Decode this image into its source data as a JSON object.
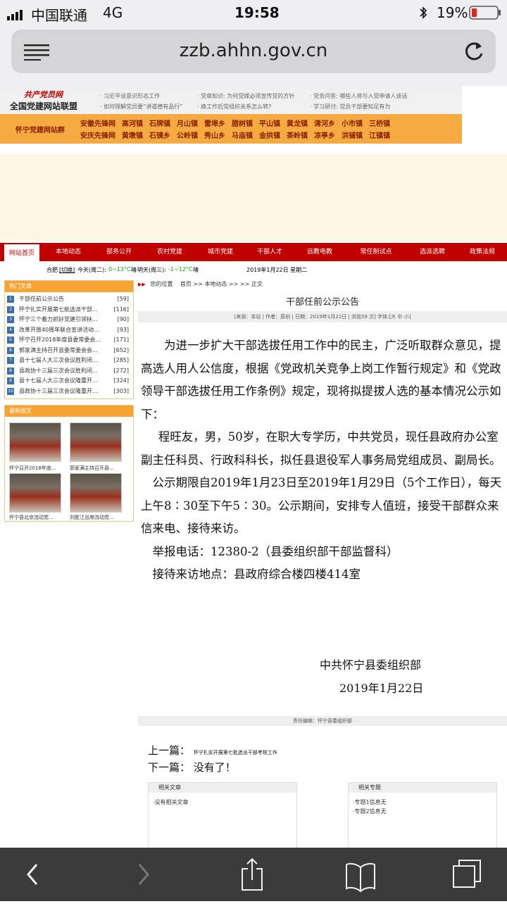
{
  "status_bar": {
    "carrier": "中国联通",
    "network": "4G",
    "time": "19:58",
    "battery": "19%"
  },
  "browser": {
    "url": "zzb.ahhn.gov.cn"
  },
  "header": {
    "logo_top": "共产党员网",
    "logo_bottom": "全国党建网站联盟",
    "links": [
      "· 习近平谈意识形态工作",
      "· 如何理解党员要“讲道德有品行”",
      "· 党章知识: 为何党媒必须宣传党的方针",
      "· 换工作后党组织关系怎么转?",
      "· 党务问答: 哪些人将与入党申请人谈话",
      "· 学习研讨: 党员干部要知足有为"
    ],
    "group_label": "怀宁党建网站群",
    "towns_row1": [
      "安徽先锋网",
      "高河镇",
      "石牌镇",
      "月山镇",
      "雷埠乡",
      "腊树镇",
      "平山镇",
      "黄龙镇",
      "清河乡",
      "小市镇",
      "三桥镇"
    ],
    "towns_row2": [
      "安庆先锋网",
      "黄墩镇",
      "石镜乡",
      "公岭镇",
      "秀山乡",
      "马庙镇",
      "金拱镇",
      "茶岭镇",
      "凉亭乡",
      "洪铺镇",
      "江镇镇"
    ]
  },
  "nav": {
    "items": [
      "网站首页",
      "本地动态",
      "部务公开",
      "农村党建",
      "城市党建",
      "干部人才",
      "远教电教",
      "常任制试点",
      "选派选聘",
      "政策法规"
    ]
  },
  "weather": {
    "city": "合肥",
    "switch": "[切换]",
    "today_label": "今天(周二):",
    "today_temp": "0~13°C",
    "today_desc": "晴",
    "tomorrow_label": "明天(周三):",
    "tomorrow_temp": "-1~12°C",
    "tomorrow_desc": "晴",
    "date": "2019年1月22日 星期二"
  },
  "hot_articles": {
    "heading": "热门文章",
    "items": [
      {
        "num": "1",
        "title": "干部任前公示公告",
        "count": "[59]"
      },
      {
        "num": "2",
        "title": "怀宁扎实开展第七批选派干部...",
        "count": "[116]"
      },
      {
        "num": "3",
        "title": "怀宁三个着力抓好党建引领扶...",
        "count": "[90]"
      },
      {
        "num": "4",
        "title": "改革开放40周年联合宣讲活动...",
        "count": "[93]"
      },
      {
        "num": "5",
        "title": "怀宁召开2018年度县委常委会...",
        "count": "[171]"
      },
      {
        "num": "6",
        "title": "郭家满主持召开县委常委会会...",
        "count": "[652]"
      },
      {
        "num": "7",
        "title": "县十七届人大三次会议胜利闭...",
        "count": "[285]"
      },
      {
        "num": "8",
        "title": "县政协十三届三次会议胜利闭...",
        "count": "[272]"
      },
      {
        "num": "9",
        "title": "县十七届人大三次会议隆重开...",
        "count": "[324]"
      },
      {
        "num": "10",
        "title": "县政协十三届三次会议隆重开...",
        "count": "[303]"
      }
    ]
  },
  "latest_photos": {
    "heading": "最新图文",
    "items": [
      "怀宁召开2018年度...",
      "郭家满主持召开县...",
      "怀宁县北京流动党...",
      "刘胜江出席流动党..."
    ]
  },
  "article": {
    "breadcrumb_label": "您的位置",
    "breadcrumb": [
      "首页",
      ">>",
      "本地动态",
      ">>",
      ">>",
      "正文"
    ],
    "title": "干部任前公示公告",
    "meta": "[来源：本站 | 作者：原创 | 日期：2019年1月22日 | 浏览59 次] 字体:[大 中 小]",
    "paragraphs": [
      "为进一步扩大干部选拔任用工作中的民主，广泛听取群众意见，提高选人用人公信度，根据《党政机关竞争上岗工作暂行规定》和《党政领导干部选拔任用工作条例》规定，现将拟提拔人选的基本情况公示如下：",
      "程旺友，男，50岁，在职大专学历，中共党员，现任县政府办公室副主任科员、行政科科长，拟任县退役军人事务局党组成员、副局长。",
      "公示期限自2019年1月23日至2019年1月29日（5个工作日），每天上午8∶30至下午5∶30。公示期间，安排专人值班，接受干部群众来信来电、接待来访。",
      "举报电话：12380-2（县委组织部干部监督科）",
      "接待来访地点：县政府综合楼四楼414室"
    ],
    "signature_org": "中共怀宁县委组织部",
    "signature_date": "2019年1月22日",
    "editor": "责任编辑：怀宁县委组织部",
    "prev_label": "上一篇：",
    "prev_title": "怀宁扎实开展第七批选派干部考核工作",
    "next_label": "下一篇：",
    "next_title": "没有了！",
    "related_articles_heading": "相关文章",
    "related_articles": [
      "·没有相关文章"
    ],
    "related_topics_heading": "相关专题",
    "related_topics": [
      "·专题1信息无",
      "·专题2信息无"
    ]
  },
  "colors": {
    "nav_red": "#c10000",
    "orange": "#f5ab42",
    "toolbar": "#3b3b3b"
  }
}
